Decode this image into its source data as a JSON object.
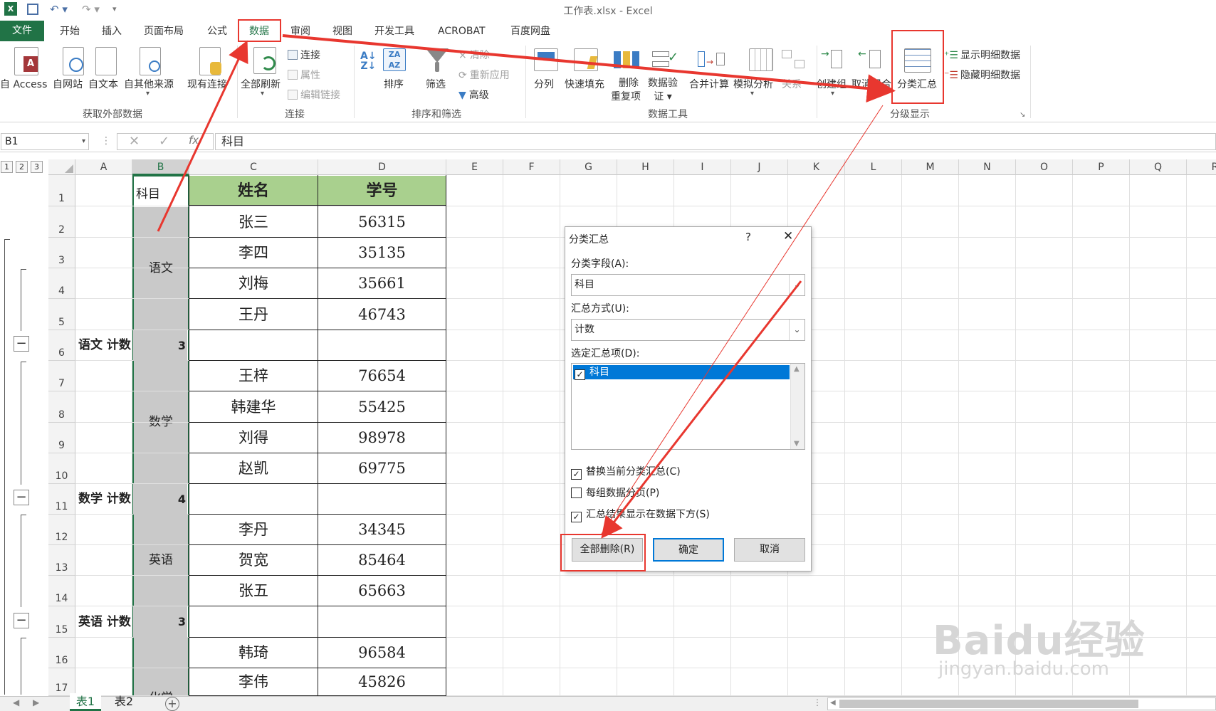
{
  "window": {
    "title": "工作表.xlsx - Excel"
  },
  "quick_access": {
    "app_icon": "excel-icon",
    "save": "save-icon",
    "undo": "undo-icon",
    "redo": "redo-icon"
  },
  "tabs": {
    "file": "文件",
    "items": [
      "开始",
      "插入",
      "页面布局",
      "公式",
      "数据",
      "审阅",
      "视图",
      "开发工具",
      "ACROBAT",
      "百度网盘"
    ],
    "active": "数据"
  },
  "ribbon": {
    "get_external": {
      "label": "获取外部数据",
      "buttons": [
        "自 Access",
        "自网站",
        "自文本",
        "自其他来源",
        "现有连接"
      ]
    },
    "connections": {
      "label": "连接",
      "refresh_all": "全部刷新",
      "connect": "连接",
      "properties": "属性",
      "edit_links": "编辑链接"
    },
    "sort_filter": {
      "label": "排序和筛选",
      "sort": "排序",
      "filter": "筛选",
      "clear": "清除",
      "reapply": "重新应用",
      "advanced": "高级"
    },
    "data_tools": {
      "label": "数据工具",
      "split": "分列",
      "flash_fill": "快速填充",
      "remove_dup_1": "删除",
      "remove_dup_2": "重复项",
      "validate_1": "数据验",
      "validate_2": "证",
      "consolidate": "合并计算",
      "whatif": "模拟分析",
      "relations": "关系"
    },
    "outline": {
      "label": "分级显示",
      "group": "创建组",
      "ungroup": "取消组合",
      "subtotal": "分类汇总",
      "show_detail": "显示明细数据",
      "hide_detail": "隐藏明细数据"
    }
  },
  "formula_bar": {
    "name_box": "B1",
    "content": "科目"
  },
  "columns": [
    "A",
    "B",
    "C",
    "D",
    "E",
    "F",
    "G",
    "H",
    "I",
    "J",
    "K",
    "L",
    "M",
    "N",
    "O",
    "P",
    "Q",
    "R"
  ],
  "outline_levels": [
    "1",
    "2",
    "3"
  ],
  "header_row": {
    "b": "科目",
    "c": "姓名",
    "d": "学号"
  },
  "rows": [
    {
      "n": "2",
      "c": "张三",
      "d": "56315"
    },
    {
      "n": "3",
      "c": "李四",
      "d": "35135"
    },
    {
      "n": "4",
      "c": "刘梅",
      "d": "35661"
    },
    {
      "n": "5",
      "c": "王丹",
      "d": "46743"
    },
    {
      "n": "6",
      "a": "语文 计数",
      "b": "3"
    },
    {
      "n": "7",
      "c": "王梓",
      "d": "76654"
    },
    {
      "n": "8",
      "c": "韩建华",
      "d": "55425"
    },
    {
      "n": "9",
      "c": "刘得",
      "d": "98978"
    },
    {
      "n": "10",
      "c": "赵凯",
      "d": "69775"
    },
    {
      "n": "11",
      "a": "数学 计数",
      "b": "4"
    },
    {
      "n": "12",
      "c": "李丹",
      "d": "34345"
    },
    {
      "n": "13",
      "c": "贺宽",
      "d": "85464"
    },
    {
      "n": "14",
      "c": "张五",
      "d": "65663"
    },
    {
      "n": "15",
      "a": "英语 计数",
      "b": "3"
    },
    {
      "n": "16",
      "c": "韩琦",
      "d": "96584"
    },
    {
      "n": "17",
      "c": "李伟",
      "d": "45826"
    }
  ],
  "merged_subjects": [
    "语文",
    "数学",
    "英语",
    "化学"
  ],
  "dialog": {
    "title": "分类汇总",
    "help": "?",
    "close": "✕",
    "field_label": "分类字段(A):",
    "field_value": "科目",
    "method_label": "汇总方式(U):",
    "method_value": "计数",
    "items_label": "选定汇总项(D):",
    "items": [
      "科目"
    ],
    "replace_current": "替换当前分类汇总(C)",
    "page_break": "每组数据分页(P)",
    "summary_below": "汇总结果显示在数据下方(S)",
    "remove_all": "全部删除(R)",
    "ok": "确定",
    "cancel": "取消"
  },
  "sheet_tabs": [
    "表1",
    "表2"
  ],
  "watermark": {
    "brand": "Baidu经验",
    "url": "jingyan.baidu.com"
  },
  "colors": {
    "excel_green": "#217346",
    "header_fill": "#a9d08e",
    "subject_fill": "#c9c9c9",
    "annotation_red": "#e8372f",
    "selection_blue": "#0078d7"
  }
}
